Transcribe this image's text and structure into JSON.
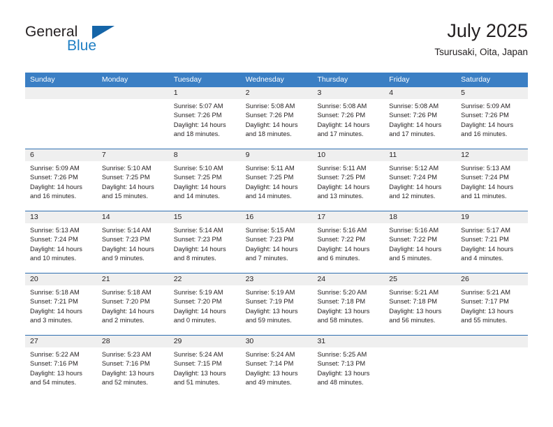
{
  "brand": {
    "name_part1": "General",
    "name_part2": "Blue",
    "triangle_color": "#1565a8",
    "blue_color": "#1f7fc4"
  },
  "header": {
    "title": "July 2025",
    "location": "Tsurusaki, Oita, Japan"
  },
  "theme": {
    "header_row_bg": "#3b7fc4",
    "day_band_bg": "#efefef",
    "week_divider": "#2f6fb0",
    "text": "#231f20"
  },
  "weekdays": [
    "Sunday",
    "Monday",
    "Tuesday",
    "Wednesday",
    "Thursday",
    "Friday",
    "Saturday"
  ],
  "weeks": [
    [
      {
        "day": "",
        "lines": []
      },
      {
        "day": "",
        "lines": []
      },
      {
        "day": "1",
        "lines": [
          "Sunrise: 5:07 AM",
          "Sunset: 7:26 PM",
          "Daylight: 14 hours",
          "and 18 minutes."
        ]
      },
      {
        "day": "2",
        "lines": [
          "Sunrise: 5:08 AM",
          "Sunset: 7:26 PM",
          "Daylight: 14 hours",
          "and 18 minutes."
        ]
      },
      {
        "day": "3",
        "lines": [
          "Sunrise: 5:08 AM",
          "Sunset: 7:26 PM",
          "Daylight: 14 hours",
          "and 17 minutes."
        ]
      },
      {
        "day": "4",
        "lines": [
          "Sunrise: 5:08 AM",
          "Sunset: 7:26 PM",
          "Daylight: 14 hours",
          "and 17 minutes."
        ]
      },
      {
        "day": "5",
        "lines": [
          "Sunrise: 5:09 AM",
          "Sunset: 7:26 PM",
          "Daylight: 14 hours",
          "and 16 minutes."
        ]
      }
    ],
    [
      {
        "day": "6",
        "lines": [
          "Sunrise: 5:09 AM",
          "Sunset: 7:26 PM",
          "Daylight: 14 hours",
          "and 16 minutes."
        ]
      },
      {
        "day": "7",
        "lines": [
          "Sunrise: 5:10 AM",
          "Sunset: 7:25 PM",
          "Daylight: 14 hours",
          "and 15 minutes."
        ]
      },
      {
        "day": "8",
        "lines": [
          "Sunrise: 5:10 AM",
          "Sunset: 7:25 PM",
          "Daylight: 14 hours",
          "and 14 minutes."
        ]
      },
      {
        "day": "9",
        "lines": [
          "Sunrise: 5:11 AM",
          "Sunset: 7:25 PM",
          "Daylight: 14 hours",
          "and 14 minutes."
        ]
      },
      {
        "day": "10",
        "lines": [
          "Sunrise: 5:11 AM",
          "Sunset: 7:25 PM",
          "Daylight: 14 hours",
          "and 13 minutes."
        ]
      },
      {
        "day": "11",
        "lines": [
          "Sunrise: 5:12 AM",
          "Sunset: 7:24 PM",
          "Daylight: 14 hours",
          "and 12 minutes."
        ]
      },
      {
        "day": "12",
        "lines": [
          "Sunrise: 5:13 AM",
          "Sunset: 7:24 PM",
          "Daylight: 14 hours",
          "and 11 minutes."
        ]
      }
    ],
    [
      {
        "day": "13",
        "lines": [
          "Sunrise: 5:13 AM",
          "Sunset: 7:24 PM",
          "Daylight: 14 hours",
          "and 10 minutes."
        ]
      },
      {
        "day": "14",
        "lines": [
          "Sunrise: 5:14 AM",
          "Sunset: 7:23 PM",
          "Daylight: 14 hours",
          "and 9 minutes."
        ]
      },
      {
        "day": "15",
        "lines": [
          "Sunrise: 5:14 AM",
          "Sunset: 7:23 PM",
          "Daylight: 14 hours",
          "and 8 minutes."
        ]
      },
      {
        "day": "16",
        "lines": [
          "Sunrise: 5:15 AM",
          "Sunset: 7:23 PM",
          "Daylight: 14 hours",
          "and 7 minutes."
        ]
      },
      {
        "day": "17",
        "lines": [
          "Sunrise: 5:16 AM",
          "Sunset: 7:22 PM",
          "Daylight: 14 hours",
          "and 6 minutes."
        ]
      },
      {
        "day": "18",
        "lines": [
          "Sunrise: 5:16 AM",
          "Sunset: 7:22 PM",
          "Daylight: 14 hours",
          "and 5 minutes."
        ]
      },
      {
        "day": "19",
        "lines": [
          "Sunrise: 5:17 AM",
          "Sunset: 7:21 PM",
          "Daylight: 14 hours",
          "and 4 minutes."
        ]
      }
    ],
    [
      {
        "day": "20",
        "lines": [
          "Sunrise: 5:18 AM",
          "Sunset: 7:21 PM",
          "Daylight: 14 hours",
          "and 3 minutes."
        ]
      },
      {
        "day": "21",
        "lines": [
          "Sunrise: 5:18 AM",
          "Sunset: 7:20 PM",
          "Daylight: 14 hours",
          "and 2 minutes."
        ]
      },
      {
        "day": "22",
        "lines": [
          "Sunrise: 5:19 AM",
          "Sunset: 7:20 PM",
          "Daylight: 14 hours",
          "and 0 minutes."
        ]
      },
      {
        "day": "23",
        "lines": [
          "Sunrise: 5:19 AM",
          "Sunset: 7:19 PM",
          "Daylight: 13 hours",
          "and 59 minutes."
        ]
      },
      {
        "day": "24",
        "lines": [
          "Sunrise: 5:20 AM",
          "Sunset: 7:18 PM",
          "Daylight: 13 hours",
          "and 58 minutes."
        ]
      },
      {
        "day": "25",
        "lines": [
          "Sunrise: 5:21 AM",
          "Sunset: 7:18 PM",
          "Daylight: 13 hours",
          "and 56 minutes."
        ]
      },
      {
        "day": "26",
        "lines": [
          "Sunrise: 5:21 AM",
          "Sunset: 7:17 PM",
          "Daylight: 13 hours",
          "and 55 minutes."
        ]
      }
    ],
    [
      {
        "day": "27",
        "lines": [
          "Sunrise: 5:22 AM",
          "Sunset: 7:16 PM",
          "Daylight: 13 hours",
          "and 54 minutes."
        ]
      },
      {
        "day": "28",
        "lines": [
          "Sunrise: 5:23 AM",
          "Sunset: 7:16 PM",
          "Daylight: 13 hours",
          "and 52 minutes."
        ]
      },
      {
        "day": "29",
        "lines": [
          "Sunrise: 5:24 AM",
          "Sunset: 7:15 PM",
          "Daylight: 13 hours",
          "and 51 minutes."
        ]
      },
      {
        "day": "30",
        "lines": [
          "Sunrise: 5:24 AM",
          "Sunset: 7:14 PM",
          "Daylight: 13 hours",
          "and 49 minutes."
        ]
      },
      {
        "day": "31",
        "lines": [
          "Sunrise: 5:25 AM",
          "Sunset: 7:13 PM",
          "Daylight: 13 hours",
          "and 48 minutes."
        ]
      },
      {
        "day": "",
        "lines": []
      },
      {
        "day": "",
        "lines": []
      }
    ]
  ]
}
